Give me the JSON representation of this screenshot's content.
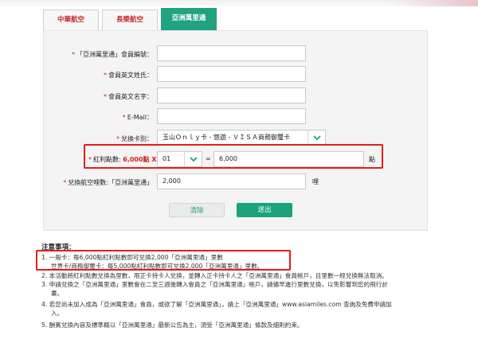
{
  "tabs": [
    {
      "label": "中華航空",
      "active": false
    },
    {
      "label": "長榮航空",
      "active": false
    },
    {
      "label": "亞洲萬里通",
      "active": true
    }
  ],
  "form": {
    "member_id_label": "「亞洲萬里通」會員編號：",
    "last_name_label": "會員英文姓氏：",
    "first_name_label": "會員英文名字：",
    "email_label": "E-Mail：",
    "card_type_label": "兌換卡別：",
    "card_type_value": "玉山Ｏｎｌｙ卡 - 悠遊 - ＶＩＳＡ商務御璽卡",
    "points_label_prefix": "紅利點數: ",
    "points_per_unit": "6,000",
    "points_label_suffix": "點 X",
    "multiplier_value": "01",
    "equals_sign": "=",
    "points_total": "6,000",
    "points_unit": "點",
    "miles_label": "兌換航空哩數:「亞洲萬里通」",
    "miles_value": "2,000",
    "miles_unit": "哩",
    "clear_button": "清除",
    "submit_button": "送出",
    "required_mark": "*"
  },
  "notes": {
    "title": "注意事項：",
    "items": [
      "1. 一般卡：每6,000點紅利點數即可兌換2,000「亞洲萬里通」里數",
      "世界卡/商務御璽卡：每5,000點紅利點數即可兌換2,000「亞洲萬里通」里數。",
      "2. 本活動將紅利點數兌換為里數，限正卡持卡人兌換，並轉入正卡持卡人之「亞洲萬里通」會員帳戶，且里數一經兌換無法取消。",
      "3. 申請兌換之「亞洲萬里通」里數會在二至三週後轉入會員之「亞洲萬里通」帳戶，請儘早進行里數兌換，以免影響到您的飛行計",
      "畫。",
      "4. 若您尚未加入成為「亞洲萬里通」會員，或欲了解「亞洲萬里通」，請上「亞洲萬里通」www.asiamiles.com 查詢及免費申請加",
      "入。",
      "5. 酬賓兌換內容及標準概以「亞洲萬里通」最新公告為主，須受「亞洲萬里通」條款及細則約束。"
    ]
  },
  "colors": {
    "accent_green": "#20a37f",
    "tab_red": "#c62828",
    "highlight_red": "#e41c1c"
  },
  "icons": {
    "dropdown": "chevron-down-icon"
  }
}
